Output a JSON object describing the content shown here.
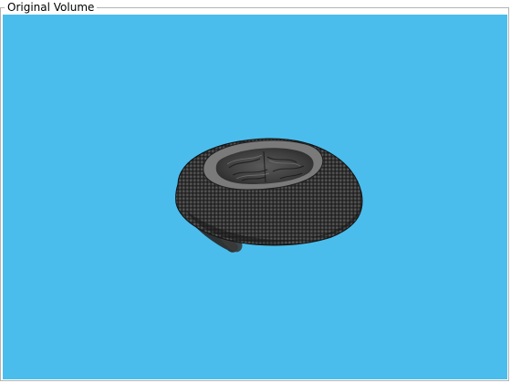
{
  "panel": {
    "title": "Original Volume"
  },
  "viewport": {
    "background_color": "#4bbded",
    "content_icon": "brain-volume-icon"
  }
}
